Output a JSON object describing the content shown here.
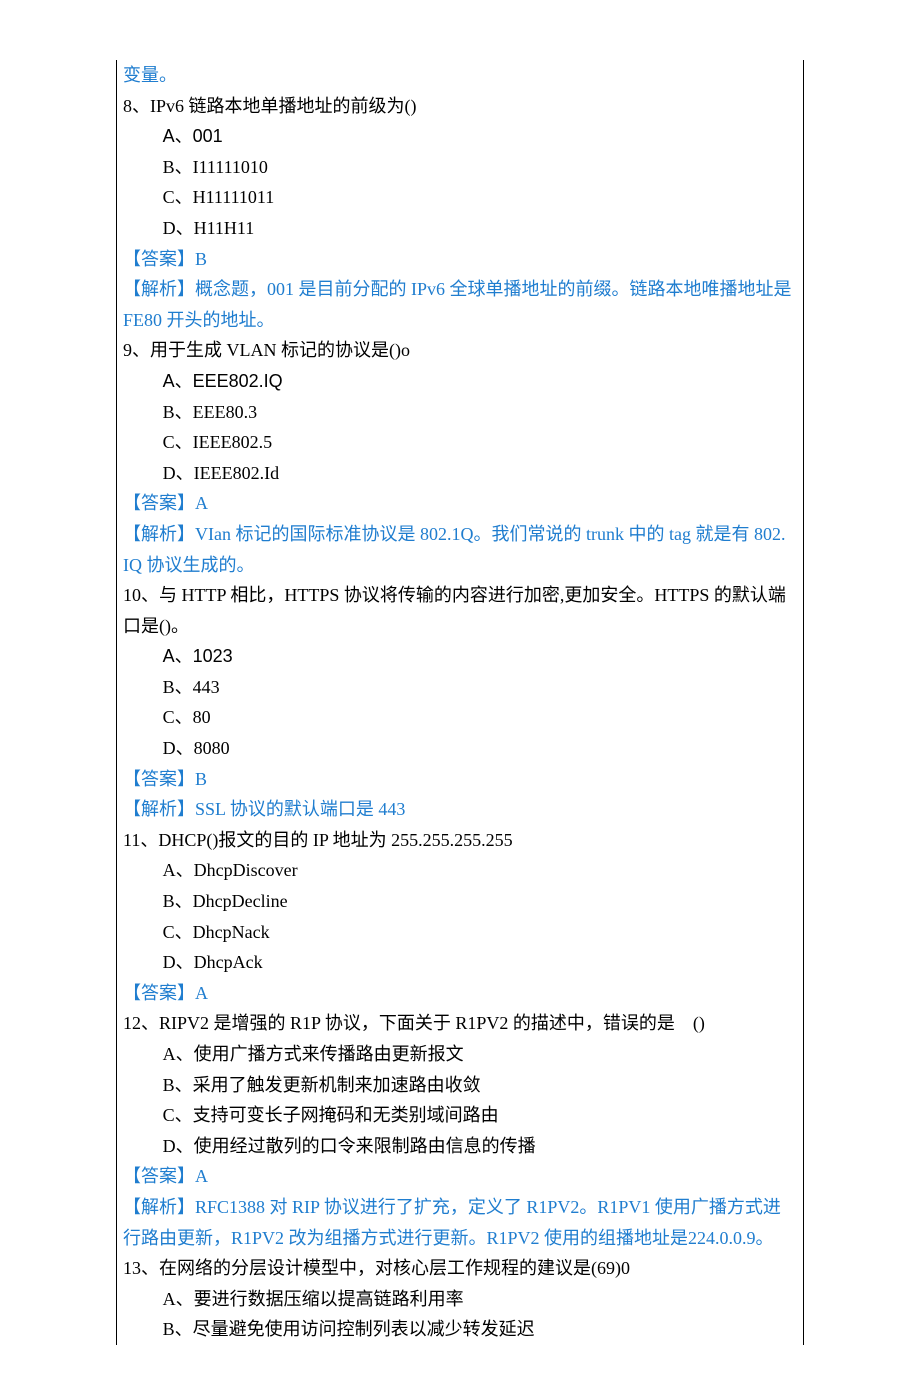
{
  "pretext": "变量。",
  "q8": {
    "stem": "8、IPv6 链路本地单播地址的前级为()",
    "A": "A、001",
    "B": "B、I11111010",
    "C": "C、H11111011",
    "D": "D、H11H11",
    "ans": "【答案】B",
    "exp": "【解析】概念题，001 是目前分配的 IPv6 全球单播地址的前缀。链路本地唯播地址是 FE80 开头的地址。"
  },
  "q9": {
    "stem": "9、用于生成 VLAN 标记的协议是()o",
    "A": "A、EEE802.IQ",
    "B": "B、EEE80.3",
    "C": "C、IEEE802.5",
    "D": "D、IEEE802.Id",
    "ans": "【答案】A",
    "exp": "【解析】VIan 标记的国际标准协议是 802.1Q。我们常说的 trunk 中的 tag 就是有 802. IQ 协议生成的。"
  },
  "q10": {
    "stem": "10、与 HTTP 相比，HTTPS 协议将传输的内容进行加密,更加安全。HTTPS 的默认端口是()。",
    "A": "A、1023",
    "B": "B、443",
    "C": "C、80",
    "D": "D、8080",
    "ans": "【答案】B",
    "exp": "【解析】SSL 协议的默认端口是 443"
  },
  "q11": {
    "stem": "11、DHCP()报文的目的 IP 地址为 255.255.255.255",
    "A": "A、DhcpDiscover",
    "B": "B、DhcpDecline",
    "C": "C、DhcpNack",
    "D": "D、DhcpAck",
    "ans": "【答案】A"
  },
  "q12": {
    "stem": "12、RIPV2 是增强的 R1P 协议，下面关于 R1PV2 的描述中，错误的是　()",
    "A": "A、使用广播方式来传播路由更新报文",
    "B": "B、采用了触发更新机制来加速路由收敛",
    "C": "C、支持可变长子网掩码和无类别域间路由",
    "D": "D、使用经过散列的口令来限制路由信息的传播",
    "ans": "【答案】A",
    "exp": "【解析】RFC1388 对 RIP 协议进行了扩充，定义了 R1PV2。R1PV1 使用广播方式进行路由更新，R1PV2 改为组播方式进行更新。R1PV2 使用的组播地址是224.0.0.9。"
  },
  "q13": {
    "stem": "13、在网络的分层设计模型中，对核心层工作规程的建议是(69)0",
    "A": "A、要进行数据压缩以提高链路利用率",
    "B": "B、尽量避免使用访问控制列表以减少转发延迟"
  }
}
